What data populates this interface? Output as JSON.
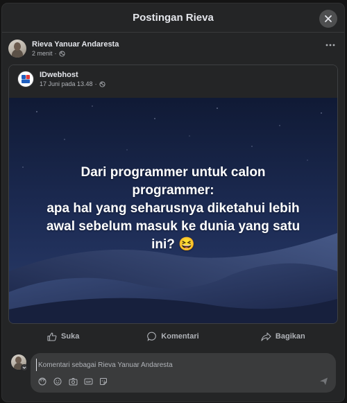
{
  "modal": {
    "title": "Postingan Rieva"
  },
  "post": {
    "author_name": "Rieva Yanuar Andaresta",
    "time": "2 menit",
    "audience_icon": "globe-icon",
    "more_icon": "more-horizontal-icon"
  },
  "shared_post": {
    "page_name": "IDwebhost",
    "time": "17 Juni pada 13.48",
    "audience_icon": "globe-icon",
    "image_text_lines": [
      "Dari programmer untuk calon",
      "programmer:",
      "apa hal yang seharusnya diketahui lebih",
      "awal sebelum masuk ke dunia yang satu",
      "ini? 😆"
    ]
  },
  "actions": {
    "like_label": "Suka",
    "comment_label": "Komentari",
    "share_label": "Bagikan"
  },
  "comment": {
    "placeholder": "Komentari sebagai Rieva Yanuar Andaresta",
    "toolbar_icons": [
      "avatar-sticker-icon",
      "emoji-icon",
      "camera-icon",
      "gif-icon",
      "sticker-icon"
    ],
    "send_icon": "send-icon"
  },
  "colors": {
    "modal_bg": "#242526",
    "input_bg": "#3a3b3c",
    "text_primary": "#e4e6eb",
    "text_secondary": "#b0b3b8"
  }
}
